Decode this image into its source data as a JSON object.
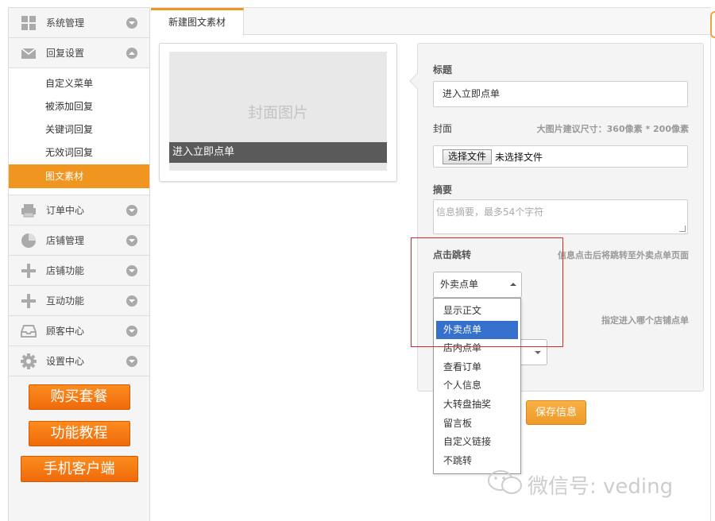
{
  "sidebar": {
    "items": [
      {
        "label": "系统管理",
        "icon": "grid-icon"
      },
      {
        "label": "回复设置",
        "icon": "mail-icon"
      }
    ],
    "sub_items": [
      "自定义菜单",
      "被添加回复",
      "关键词回复",
      "无效词回复",
      "图文素材"
    ],
    "active_sub": "图文素材",
    "items_after": [
      {
        "label": "订单中心",
        "icon": "printer-icon"
      },
      {
        "label": "店铺管理",
        "icon": "pie-chart-icon"
      },
      {
        "label": "店铺功能",
        "icon": "plus-icon"
      },
      {
        "label": "互动功能",
        "icon": "plus-icon"
      },
      {
        "label": "顾客中心",
        "icon": "inbox-icon"
      },
      {
        "label": "设置中心",
        "icon": "gear-icon"
      }
    ],
    "buy_label": "购买套餐",
    "tutorial_label": "功能教程",
    "mobile_label": "手机客户端"
  },
  "tab": {
    "label": "新建图文素材"
  },
  "preview": {
    "cover_placeholder": "封面图片",
    "title": "进入立即点单"
  },
  "form": {
    "title_label": "标题",
    "title_value": "进入立即点单",
    "cover_label": "封面",
    "cover_hint": "大图片建议尺寸：360像素 * 200像素",
    "file_button": "选择文件",
    "file_status": "未选择文件",
    "summary_label": "摘要",
    "summary_placeholder": "信息摘要，最多54个字符",
    "jump_label": "点击跳转",
    "jump_hint": "信息点击后将跳转至外卖点单页面",
    "jump_value": "外卖点单",
    "store_hint": "指定进入哪个店铺点单",
    "save_label": "保存信息"
  },
  "dropdown": {
    "options": [
      "显示正文",
      "外卖点单",
      "店内点单",
      "查看订单",
      "个人信息",
      "大转盘抽奖",
      "留言板",
      "自定义链接",
      "不跳转"
    ],
    "selected": "外卖点单"
  },
  "watermark": {
    "text": "微信号: veding"
  },
  "colors": {
    "accent": "#f0951f",
    "selection": "#3470cc",
    "highlight": "#d42b2b"
  }
}
